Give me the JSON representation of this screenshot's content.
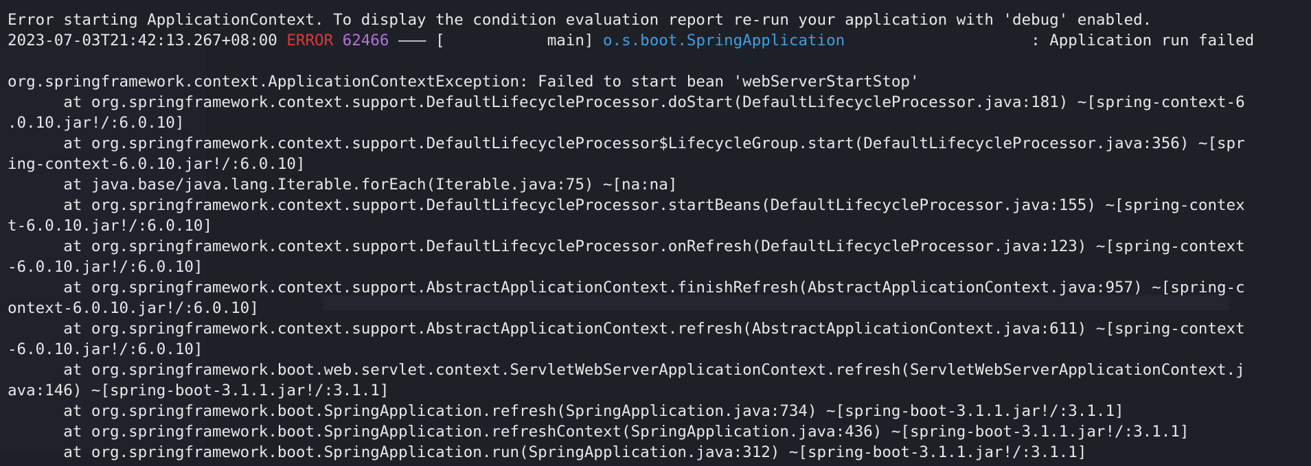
{
  "header": {
    "error_message": "Error starting ApplicationContext. To display the condition evaluation report re-run your application with 'debug' enabled.",
    "log_timestamp": "2023-07-03T21:42:13.267+08:00",
    "log_level": "ERROR",
    "log_pid": "62466",
    "log_separator": " ––– [",
    "log_thread": "           main] ",
    "log_logger": "o.s.boot.SpringApplication",
    "log_message": "                    : Application run failed"
  },
  "stack_trace": {
    "exception": "org.springframework.context.ApplicationContextException: Failed to start bean 'webServerStartStop'",
    "lines": [
      "      at org.springframework.context.support.DefaultLifecycleProcessor.doStart(DefaultLifecycleProcessor.java:181) ~[spring-context-6",
      ".0.10.jar!/:6.0.10]",
      "      at org.springframework.context.support.DefaultLifecycleProcessor$LifecycleGroup.start(DefaultLifecycleProcessor.java:356) ~[spr",
      "ing-context-6.0.10.jar!/:6.0.10]",
      "      at java.base/java.lang.Iterable.forEach(Iterable.java:75) ~[na:na]",
      "      at org.springframework.context.support.DefaultLifecycleProcessor.startBeans(DefaultLifecycleProcessor.java:155) ~[spring-contex",
      "t-6.0.10.jar!/:6.0.10]",
      "      at org.springframework.context.support.DefaultLifecycleProcessor.onRefresh(DefaultLifecycleProcessor.java:123) ~[spring-context",
      "-6.0.10.jar!/:6.0.10]",
      "      at org.springframework.context.support.AbstractApplicationContext.finishRefresh(AbstractApplicationContext.java:957) ~[spring-c",
      "ontext-6.0.10.jar!/:6.0.10]",
      "      at org.springframework.context.support.AbstractApplicationContext.refresh(AbstractApplicationContext.java:611) ~[spring-context",
      "-6.0.10.jar!/:6.0.10]",
      "      at org.springframework.boot.web.servlet.context.ServletWebServerApplicationContext.refresh(ServletWebServerApplicationContext.j",
      "ava:146) ~[spring-boot-3.1.1.jar!/:3.1.1]",
      "      at org.springframework.boot.SpringApplication.refresh(SpringApplication.java:734) ~[spring-boot-3.1.1.jar!/:3.1.1]",
      "      at org.springframework.boot.SpringApplication.refreshContext(SpringApplication.java:436) ~[spring-boot-3.1.1.jar!/:3.1.1]",
      "      at org.springframework.boot.SpringApplication.run(SpringApplication.java:312) ~[spring-boot-3.1.1.jar!/:3.1.1]"
    ]
  },
  "colors": {
    "background": "#1e2028",
    "text": "#e8e8e8",
    "error_level": "#d93a3a",
    "pid": "#b374d6",
    "logger": "#3f9fe0"
  }
}
